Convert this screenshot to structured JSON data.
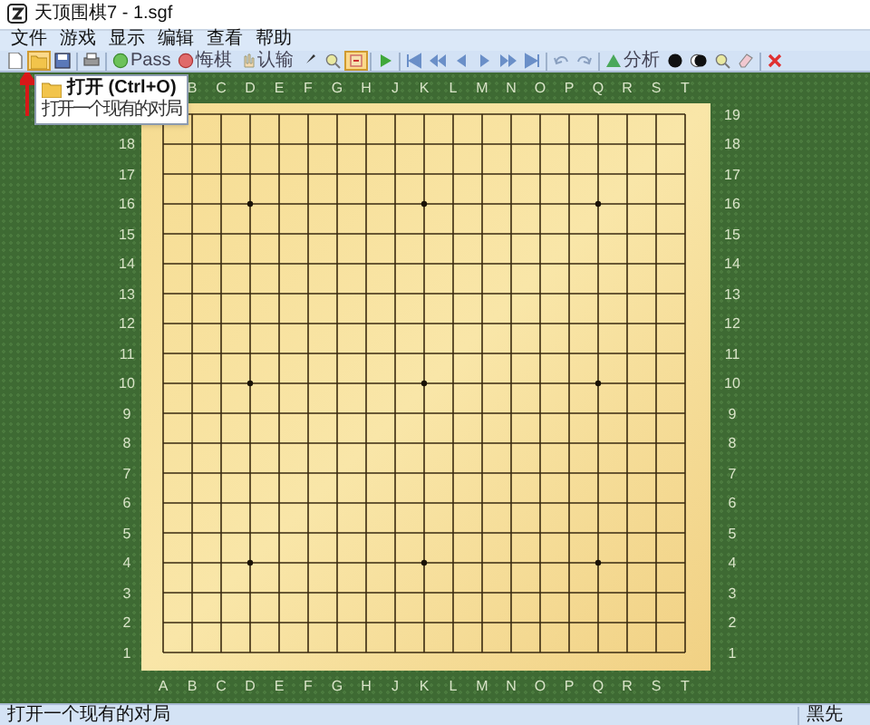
{
  "window": {
    "title": "天顶围棋7 - 1.sgf"
  },
  "menu": [
    "文件",
    "游戏",
    "显示",
    "编辑",
    "查看",
    "帮助"
  ],
  "toolbar_groups": [
    {
      "items": [
        {
          "kind": "new",
          "selected": false
        },
        {
          "kind": "open",
          "selected": true
        },
        {
          "kind": "save",
          "selected": false
        }
      ]
    },
    {
      "items": [
        {
          "kind": "print",
          "selected": false
        }
      ]
    },
    {
      "items": [
        {
          "kind": "pass",
          "label": "Pass",
          "selected": false
        },
        {
          "kind": "undo-move",
          "label": "悔棋",
          "selected": false
        },
        {
          "kind": "resign",
          "label": "认输",
          "selected": false
        },
        {
          "kind": "brush",
          "selected": false
        },
        {
          "kind": "hint",
          "selected": false
        },
        {
          "kind": "marker",
          "selected": true
        }
      ]
    },
    {
      "items": [
        {
          "kind": "play",
          "selected": false
        }
      ]
    },
    {
      "items": [
        {
          "kind": "first",
          "selected": false
        },
        {
          "kind": "fast-back",
          "selected": false
        },
        {
          "kind": "back",
          "selected": false
        },
        {
          "kind": "forward",
          "selected": false
        },
        {
          "kind": "fast-forward",
          "selected": false
        },
        {
          "kind": "last",
          "selected": false
        }
      ]
    },
    {
      "items": [
        {
          "kind": "undo",
          "selected": false
        },
        {
          "kind": "redo",
          "selected": false
        }
      ]
    },
    {
      "items": [
        {
          "kind": "analysis",
          "label": "分析",
          "selected": false
        },
        {
          "kind": "stone",
          "selected": false
        },
        {
          "kind": "stones",
          "selected": false
        },
        {
          "kind": "hint",
          "selected": false
        },
        {
          "kind": "eraser",
          "selected": false
        }
      ]
    },
    {
      "items": [
        {
          "kind": "close",
          "selected": false
        }
      ]
    }
  ],
  "tooltip": {
    "title": "打开 (Ctrl+O)",
    "description": "打开一个现有的对局"
  },
  "board": {
    "top_columns": [
      "B",
      "C",
      "D",
      "E",
      "F",
      "G",
      "H",
      "J",
      "K",
      "L",
      "M",
      "N",
      "O",
      "P",
      "Q",
      "R",
      "S",
      "T"
    ],
    "bottom_columns": [
      "A",
      "B",
      "C",
      "D",
      "E",
      "F",
      "G",
      "H",
      "J",
      "K",
      "L",
      "M",
      "N",
      "O",
      "P",
      "Q",
      "R",
      "S",
      "T"
    ],
    "left_rows": [
      "18",
      "17",
      "16",
      "15",
      "14",
      "13",
      "12",
      "11",
      "10",
      "9",
      "8",
      "7",
      "6",
      "5",
      "4",
      "3",
      "2",
      "1"
    ],
    "right_rows": [
      "19",
      "18",
      "17",
      "16",
      "15",
      "14",
      "13",
      "12",
      "11",
      "10",
      "9",
      "8",
      "7",
      "6",
      "5",
      "4",
      "3",
      "2",
      "1"
    ]
  },
  "status_bar": {
    "message": "打开一个现有的对局",
    "turn": "黑先"
  }
}
